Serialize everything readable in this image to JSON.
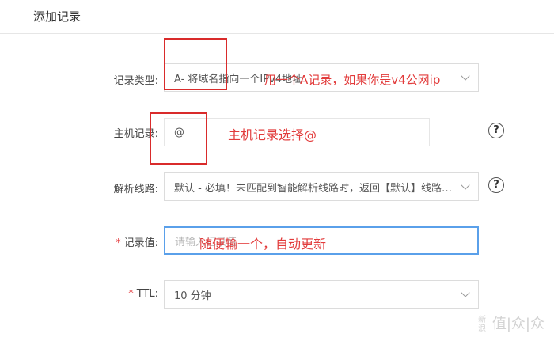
{
  "dialog": {
    "title": "添加记录"
  },
  "form": {
    "record_type": {
      "label": "记录类型:",
      "value": "A- 将域名指向一个IPv4地址"
    },
    "host": {
      "label": "主机记录:",
      "value": "@"
    },
    "line": {
      "label": "解析线路:",
      "value": "默认 - 必填！未匹配到智能解析线路时，返回【默认】线路设..."
    },
    "record_value": {
      "label": "记录值:",
      "required_mark": "*",
      "placeholder": "请输入记录值"
    },
    "ttl": {
      "label": "TTL:",
      "required_mark": "*",
      "value": "10 分钟"
    }
  },
  "annotations": {
    "type_note": "用一个A记录，如果你是v4公网ip",
    "host_note": "主机记录选择@",
    "value_note": "随便输一个，自动更新"
  },
  "watermark": {
    "text": "值|众|众",
    "small": "新浪"
  },
  "colors": {
    "annotation": "#e23b3b",
    "focus": "#5aa0ea"
  }
}
